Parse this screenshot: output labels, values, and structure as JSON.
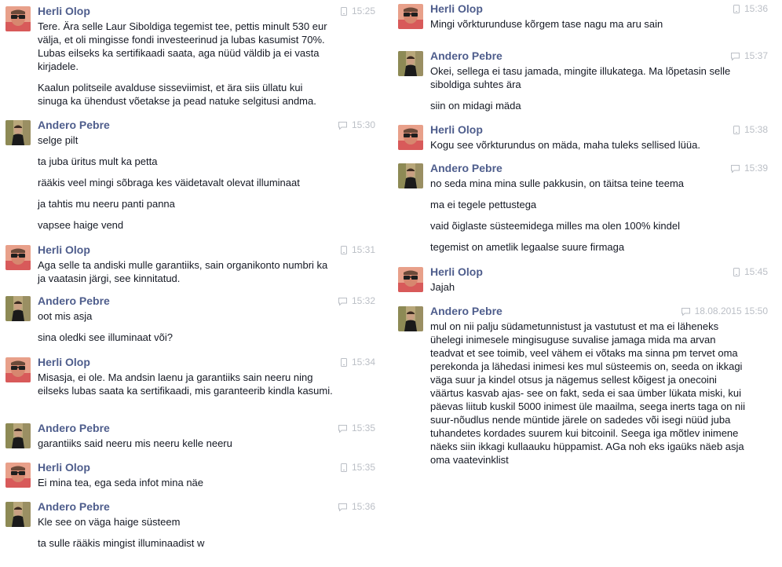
{
  "messages_left": [
    {
      "sender": "Herli Olop",
      "avatar": "herli",
      "device": "phone",
      "time": "15:25",
      "lines": [
        "Tere. Ära selle Laur Siboldiga tegemist tee, pettis minult 530 eur välja, et oli mingisse fondi investeerinud ja lubas kasumist 70%. Lubas eilseks ka sertifikaadi saata, aga nüüd väldib ja ei vasta kirjadele.",
        "Kaalun politseile avalduse sisseviimist, et ära siis üllatu kui sinuga ka ühendust võetakse ja pead natuke selgitusi andma."
      ]
    },
    {
      "sender": "Andero Pebre",
      "avatar": "andero",
      "device": "chat",
      "time": "15:30",
      "lines": [
        "selge pilt",
        "ta juba üritus mult ka petta",
        "rääkis veel mingi sõbraga kes väidetavalt olevat illuminaat",
        "ja tahtis mu neeru panti panna",
        "vapsee haige vend"
      ]
    },
    {
      "sender": "Herli Olop",
      "avatar": "herli",
      "device": "phone",
      "time": "15:31",
      "lines": [
        "Aga selle ta andiski mulle garantiiks, sain organikonto numbri ka ja vaatasin järgi, see kinnitatud."
      ]
    },
    {
      "sender": "Andero Pebre",
      "avatar": "andero",
      "device": "chat",
      "time": "15:32",
      "lines": [
        "oot mis asja",
        "sina oledki see illuminaat või?"
      ]
    },
    {
      "sender": "Herli Olop",
      "avatar": "herli",
      "device": "phone",
      "time": "15:34",
      "lines": [
        "Misasja, ei ole. Ma andsin laenu ja garantiiks sain neeru ning eilseks lubas saata ka sertifikaadi, mis garanteerib kindla kasumi."
      ]
    },
    {
      "sender": "Andero Pebre",
      "avatar": "andero",
      "device": "chat",
      "time": "15:35",
      "lines": [
        "garantiiks said neeru mis neeru kelle neeru"
      ]
    },
    {
      "sender": "Herli Olop",
      "avatar": "herli",
      "device": "phone",
      "time": "15:35",
      "lines": [
        "Ei mina tea, ega seda infot mina näe"
      ]
    },
    {
      "sender": "Andero Pebre",
      "avatar": "andero",
      "device": "chat",
      "time": "15:36",
      "lines": [
        "Kle see on väga haige süsteem",
        "ta sulle rääkis mingist illuminaadist w"
      ]
    }
  ],
  "messages_right": [
    {
      "sender": "Herli Olop",
      "avatar": "herli",
      "device": "phone",
      "time": "15:36",
      "lines": [
        "Mingi võrkturunduse kõrgem tase nagu ma aru sain"
      ]
    },
    {
      "sender": "Andero Pebre",
      "avatar": "andero",
      "device": "chat",
      "time": "15:37",
      "lines": [
        "Okei, sellega ei tasu jamada, mingite illukategа. Ma lõpetasin selle siboldiga suhtes ära",
        "siin on midagi mäda"
      ]
    },
    {
      "sender": "Herli Olop",
      "avatar": "herli",
      "device": "phone",
      "time": "15:38",
      "lines": [
        "Kogu see võrkturundus on mäda, maha tuleks sellised lüüa."
      ]
    },
    {
      "sender": "Andero Pebre",
      "avatar": "andero",
      "device": "chat",
      "time": "15:39",
      "lines": [
        "no seda mina mina sulle pakkusin, on täitsa teine teema",
        "ma ei tegele pettustega",
        "vaid õiglaste süsteemidega milles ma olen 100% kindel",
        "tegemist on ametlik legaalse suure firmaga"
      ]
    },
    {
      "sender": "Herli Olop",
      "avatar": "herli",
      "device": "phone",
      "time": "15:45",
      "lines": [
        "Jajah"
      ]
    },
    {
      "sender": "Andero Pebre",
      "avatar": "andero",
      "device": "chat",
      "time": "18.08.2015 15:50",
      "lines": [
        "mul on nii palju südametunnistust ja vastutust et ma ei läheneks ühelegi inimesele mingisuguse suvalise jamaga mida ma arvan teadvat et see toimib, veel vähem ei võtaks ma sinna pm tervet oma perekonda ja lähedasi inimesi kes mul süsteemis on,  seeda on ikkagi väga suur ja kindel otsus ja nägemus sellest kõigest ja onecoini väärtus kasvab ajas- see on fakt, seda ei saa ümber lükata miski, kui päevas liitub kuskil 5000 inimest üle maailma, seega inerts taga on nii suur-nõudlus nende müntide järele on sadedes või isegi nüüd juba tuhandetes kordades suurem kui bitcoinil. Seega iga mõtlev inimene näeks siin ikkagi kullaauku hüppamist. AGa noh eks igaüks näeb asja oma vaatevinklist"
      ]
    }
  ],
  "colors": {
    "name": "#4e5d8c",
    "meta": "#bbbfc6",
    "text": "#141823"
  }
}
